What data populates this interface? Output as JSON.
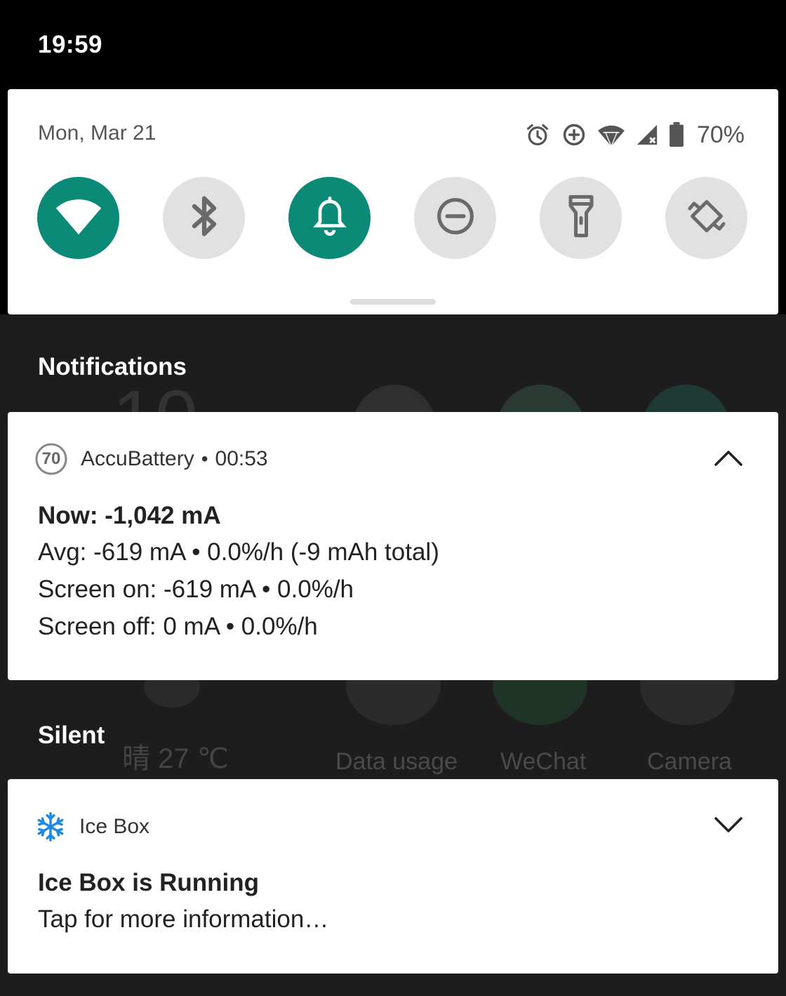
{
  "status_bar": {
    "time": "19:59"
  },
  "quick_settings": {
    "date": "Mon, Mar 21",
    "battery_percent": "70%",
    "status_icons": [
      "alarm-icon",
      "data-saver-icon",
      "wifi-signal-icon",
      "cell-signal-icon",
      "battery-icon"
    ],
    "tiles": [
      {
        "name": "wifi",
        "icon": "wifi-icon",
        "state": "on"
      },
      {
        "name": "bluetooth",
        "icon": "bluetooth-icon",
        "state": "off"
      },
      {
        "name": "sound",
        "icon": "bell-icon",
        "state": "on"
      },
      {
        "name": "do-not-disturb",
        "icon": "do-not-disturb-icon",
        "state": "off"
      },
      {
        "name": "flashlight",
        "icon": "flashlight-icon",
        "state": "off"
      },
      {
        "name": "auto-rotate",
        "icon": "auto-rotate-icon",
        "state": "off"
      }
    ],
    "accent_color": "#0b8a78"
  },
  "sections": {
    "notifications": "Notifications",
    "silent": "Silent"
  },
  "background": {
    "clock_fragment": "10",
    "weather": "晴 27 ℃",
    "apps": [
      "Data usage",
      "WeChat",
      "Camera"
    ]
  },
  "accubattery": {
    "app_icon_text": "70",
    "app_name": "AccuBattery",
    "time": "00:53",
    "now": "Now: -1,042 mA",
    "avg": "Avg: -619 mA • 0.0%/h (-9 mAh total)",
    "screen_on": "Screen on: -619 mA • 0.0%/h",
    "screen_off": "Screen off: 0 mA • 0.0%/h"
  },
  "icebox": {
    "app_name": "Ice Box",
    "title": "Ice Box is Running",
    "text": "Tap for more information…"
  }
}
